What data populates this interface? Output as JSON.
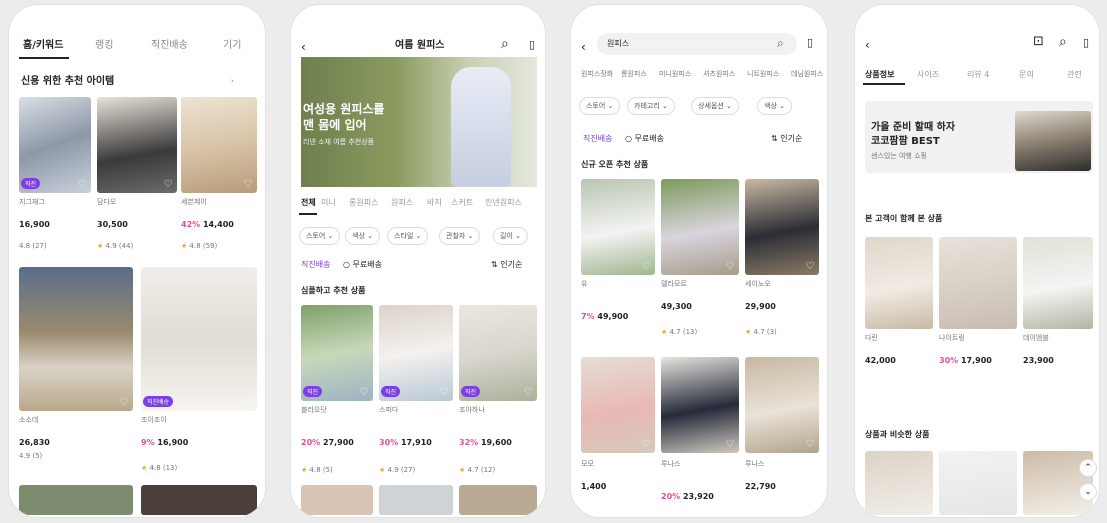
{
  "screen1": {
    "tabs": [
      "홈/키워드",
      "랭킹",
      "직진배송",
      "기기"
    ],
    "section_title": "신용 위한 추천 아이템",
    "products_row1": [
      {
        "store": "지그재그",
        "discount": "",
        "price": "16,900",
        "rating": "4.8 (27)",
        "tag": "직진"
      },
      {
        "store": "담다오",
        "discount": "",
        "price": "30,500",
        "rating": "4.9 (44)",
        "tag": ""
      },
      {
        "store": "세븐제이",
        "discount": "42%",
        "price": "14,400",
        "rating": "4.8 (59)",
        "tag": ""
      }
    ],
    "products_row2": [
      {
        "store": "소소데",
        "discount": "",
        "price": "26,830",
        "rating": "4.9 (5)",
        "tag": ""
      },
      {
        "store": "조이조이",
        "discount": "9%",
        "price": "16,900",
        "rating": "4.8 (13)",
        "tag": "직진배송"
      }
    ]
  },
  "screen2": {
    "title": "여름 원피스",
    "banner_text": [
      "여성용 원피스를",
      "맨 몸에 입어"
    ],
    "banner_sub": "리넨 소재 여름 추천상품",
    "cats": [
      "전체",
      "미니",
      "롱원피스",
      "원피스",
      "바지",
      "스커트",
      "린넨원피스"
    ],
    "filters": [
      "스토어",
      "색상",
      "스타일",
      "관찰자",
      "길이"
    ],
    "sort_label": "직진배송",
    "sort_check": "무료배송",
    "sort_right": "인기순",
    "section_title": "심플하고 추천 상품",
    "products": [
      {
        "store": "블라오닷",
        "discount": "20%",
        "price": "27,900",
        "rating": "4.8 (5)",
        "tag": "직진"
      },
      {
        "store": "스피다",
        "discount": "30%",
        "price": "17,910",
        "rating": "4.9 (27)",
        "tag": "직진"
      },
      {
        "store": "조아하나",
        "discount": "32%",
        "price": "19,600",
        "rating": "4.7 (12)",
        "tag": "직진"
      }
    ]
  },
  "screen3": {
    "search_value": "원피스",
    "cats": [
      "원피스장화",
      "롱원피스",
      "미니원피스",
      "셔츠원피스",
      "니트원피스",
      "데님원피스"
    ],
    "filters": [
      "스토어",
      "카테고리",
      "상세옵션",
      "색상"
    ],
    "sort_label": "직진배송",
    "sort_check": "무료배송",
    "sort_right": "인기순",
    "section_title": "신규 오픈 추천 상품",
    "products_row1": [
      {
        "store": "유",
        "discount": "7%",
        "price": "49,900",
        "rating": "",
        "tag": ""
      },
      {
        "store": "델라모르",
        "discount": "",
        "price": "49,300",
        "rating": "4.7 (13)",
        "tag": ""
      },
      {
        "store": "세이노오",
        "discount": "",
        "price": "29,900",
        "rating": "4.7 (3)",
        "tag": ""
      }
    ],
    "products_row2": [
      {
        "store": "모모",
        "discount": "",
        "price": "1,400",
        "rating": "",
        "tag": ""
      },
      {
        "store": "루나스",
        "discount": "20%",
        "price": "23,920",
        "rating": "",
        "tag": ""
      },
      {
        "store": "루나스",
        "discount": "",
        "price": "22,790",
        "rating": "",
        "tag": ""
      }
    ]
  },
  "screen4": {
    "tabs": [
      "상품정보",
      "사이즈",
      "리뷰 4",
      "문의",
      "관련"
    ],
    "banner_title": [
      "가을 준비 할때 하자",
      "코코팜팜 BEST"
    ],
    "banner_sub": "센스있는 여행 쇼핑",
    "section1_title": "본 고객이 함께 본 상품",
    "products": [
      {
        "store": "다린",
        "discount": "",
        "price": "42,000",
        "rating": ""
      },
      {
        "store": "나이트링",
        "discount": "30%",
        "price": "17,900",
        "rating": ""
      },
      {
        "store": "데이엠블",
        "discount": "",
        "price": "23,900",
        "rating": ""
      }
    ],
    "section2_title": "상품과 비슷한 상품"
  }
}
